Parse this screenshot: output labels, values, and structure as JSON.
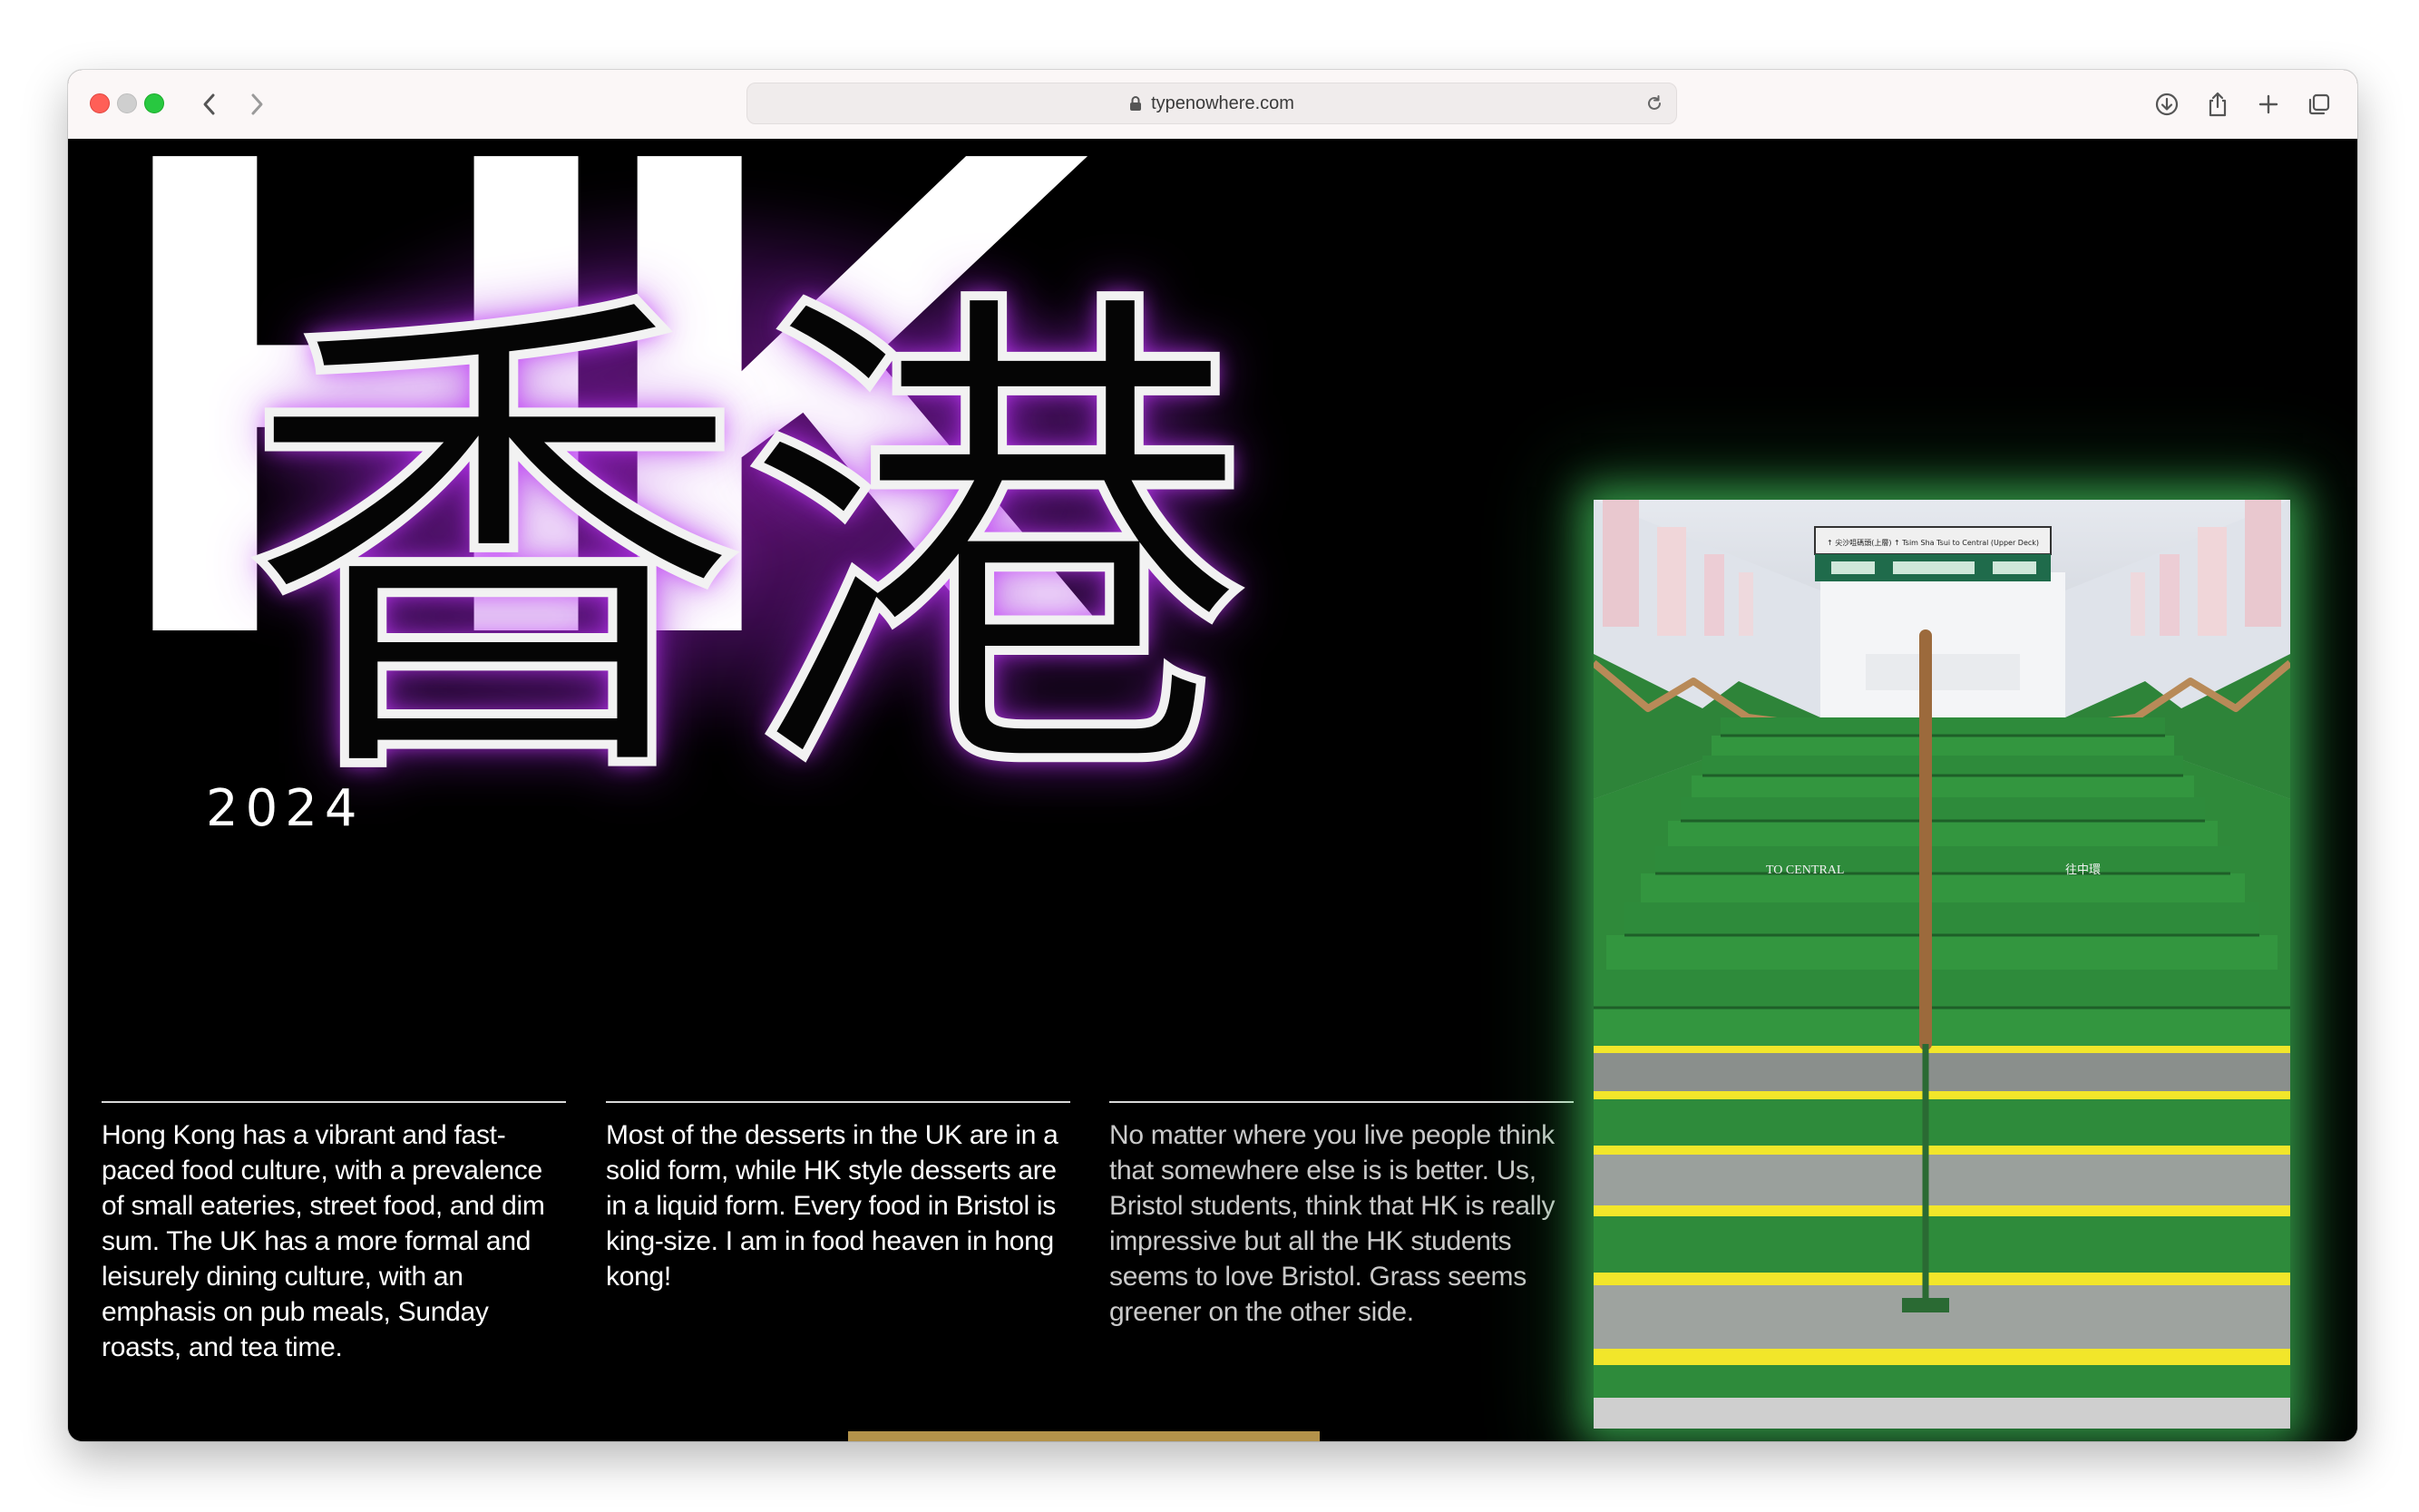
{
  "browser": {
    "url": "typenowhere.com"
  },
  "hero": {
    "latin_title": "HK",
    "cjk_title": "香港",
    "year": "2024"
  },
  "columns": [
    {
      "text": "Hong Kong has a vibrant and fast-paced food culture, with a prevalence of small eateries, street food, and dim sum. The UK has a more formal and leisurely dining culture, with an emphasis on pub meals, Sunday roasts, and tea time."
    },
    {
      "text": "Most of the desserts in the UK are in a solid form, while HK style desserts are in a liquid form. Every food in Bristol is king-size. I am in food heaven in hong kong!"
    },
    {
      "text": "No matter where you live people think that somewhere else is is better. Us, Bristol students, think that HK is really impressive but all the HK students seems to love Bristol. Grass seems greener on the other side."
    }
  ],
  "photo": {
    "header_sign": "↑ 尖沙咀碼頭(上層)  ↑ Tsim Sha Tsui to Central (Upper Deck)",
    "step_label_en": "TO CENTRAL",
    "step_label_zh": "往中環"
  },
  "colors": {
    "accent_purple": "#8a1fb0",
    "glow_green": "#50e66e",
    "stairs_green": "#2f8f3c",
    "stripe_yellow": "#f2e62a",
    "scroll_bar": "#b3924a"
  },
  "icons": [
    "back-icon",
    "forward-icon",
    "lock-icon",
    "reload-icon",
    "download-icon",
    "share-icon",
    "new-tab-icon",
    "tabs-overview-icon"
  ]
}
